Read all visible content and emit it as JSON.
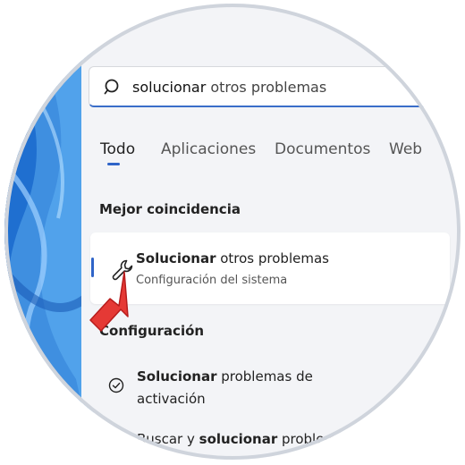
{
  "search": {
    "query_bold": "solucionar",
    "query_rest": " otros problemas",
    "icon": "search-icon"
  },
  "tabs": [
    {
      "label": "Todo",
      "active": true
    },
    {
      "label": "Aplicaciones",
      "active": false
    },
    {
      "label": "Documentos",
      "active": false
    },
    {
      "label": "Web",
      "active": false
    }
  ],
  "best_match": {
    "section_title": "Mejor coincidencia",
    "title_bold": "Solucionar",
    "title_rest": " otros problemas",
    "subtitle": "Configuración del sistema",
    "icon": "wrench-icon"
  },
  "settings": {
    "section_title": "Configuración",
    "items": [
      {
        "bold": "Solucionar",
        "rest": " problemas de activación",
        "icon": "check-circle-icon"
      },
      {
        "pre": "Buscar y ",
        "bold": "solucionar",
        "rest": " problemas"
      }
    ]
  },
  "colors": {
    "accent": "#2f64c8",
    "arrow": "#e53935",
    "panel": "#f3f4f7"
  }
}
